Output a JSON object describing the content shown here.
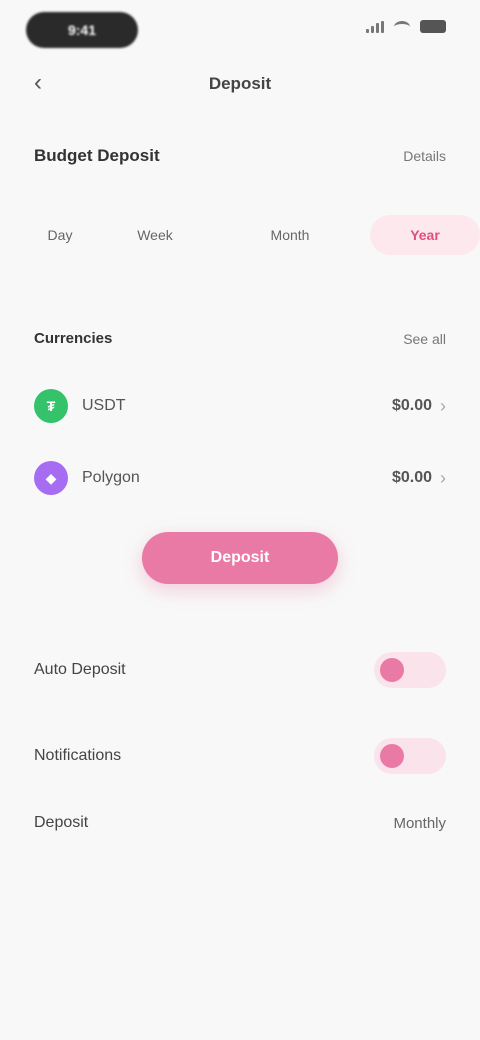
{
  "status_bar": {
    "time": "9:41"
  },
  "header": {
    "back_icon": "arrow-left-icon",
    "title": "Deposit"
  },
  "section_budget": {
    "title": "Budget Deposit",
    "link": "Details"
  },
  "tabs": [
    {
      "label": "Day"
    },
    {
      "label": "Week"
    },
    {
      "label": "Month"
    },
    {
      "label": "Year",
      "selected": true
    }
  ],
  "section_currencies": {
    "title": "Currencies",
    "link": "See all"
  },
  "coins": [
    {
      "name": "USDT",
      "value": "$0.00",
      "icon": "usdt-icon",
      "color": "#34c26a"
    },
    {
      "name": "Polygon",
      "value": "$0.00",
      "icon": "polygon-icon",
      "color": "#a66df2"
    }
  ],
  "primary_button": {
    "label": "Deposit"
  },
  "settings": {
    "toggle_1_label": "Auto Deposit",
    "toggle_2_label": "Notifications",
    "row_label": "Deposit",
    "row_value": "Monthly"
  },
  "colors": {
    "accent": "#e97aa5",
    "accent_soft": "#fbe3ec",
    "background": "#f8f8f8"
  }
}
